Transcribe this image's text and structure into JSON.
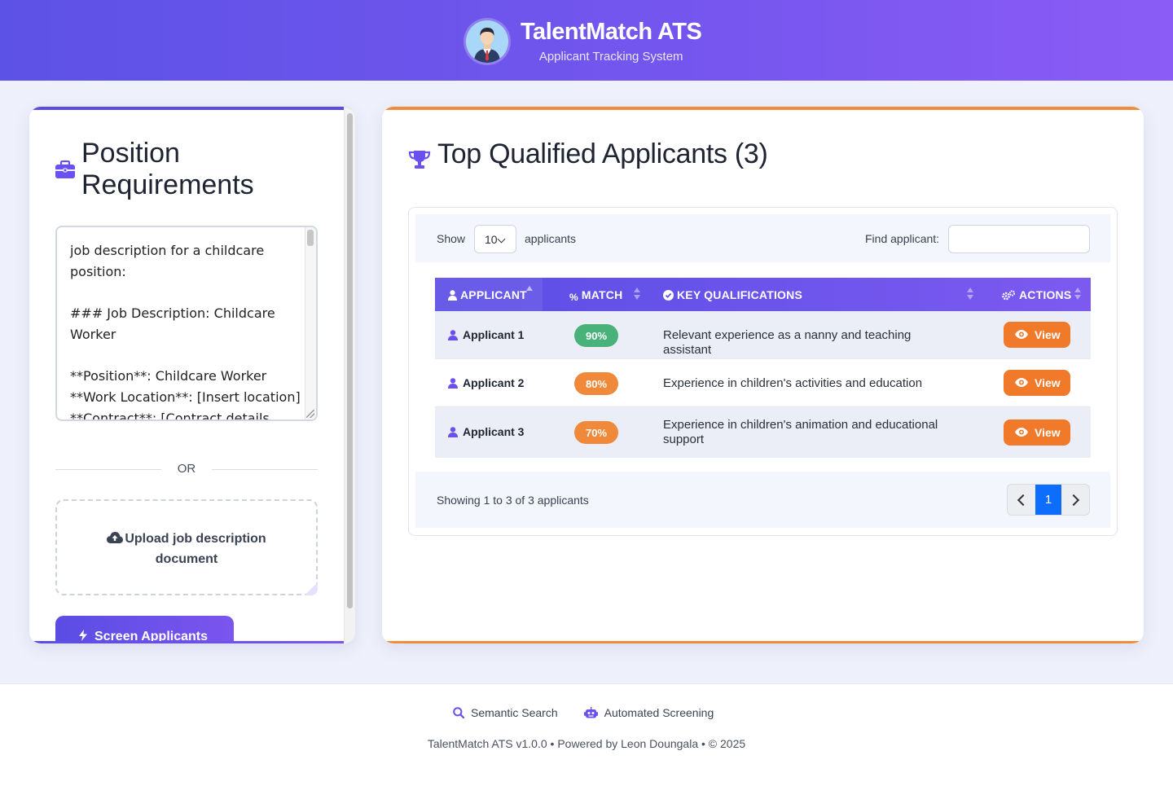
{
  "header": {
    "title": "TalentMatch ATS",
    "subtitle": "Applicant Tracking System"
  },
  "left": {
    "title": "Position Requirements",
    "job_description": "job description for a childcare position:\n\n### Job Description: Childcare Worker\n\n**Position**: Childcare Worker\n**Work Location**: [Insert location]\n**Contract**: [Contract details",
    "or_label": "OR",
    "upload_label": "Upload job description document",
    "screen_button": "Screen Applicants"
  },
  "right": {
    "title": "Top Qualified Applicants (3)",
    "show_label": "Show",
    "page_size": "10",
    "applicants_label": "applicants",
    "find_label": "Find applicant:",
    "find_value": "",
    "columns": [
      "APPLICANT",
      "MATCH",
      "KEY QUALIFICATIONS",
      "ACTIONS"
    ],
    "rows": [
      {
        "name": "Applicant 1",
        "match": "90%",
        "qualifications": "Relevant experience as a nanny and teaching assistant",
        "action": "View"
      },
      {
        "name": "Applicant 2",
        "match": "80%",
        "qualifications": "Experience in children's activities and education",
        "action": "View"
      },
      {
        "name": "Applicant 3",
        "match": "70%",
        "qualifications": "Experience in children's animation and educational support",
        "action": "View"
      }
    ],
    "info": "Showing 1 to 3 of 3 applicants",
    "current_page": "1"
  },
  "colors": {
    "primary": "#5b4de0",
    "accent": "#f07a2a",
    "match_high": "#48b27a",
    "match_mid": "#f08a3a",
    "page_active": "#0d6efd"
  },
  "footer": {
    "link1": "Semantic Search",
    "link2": "Automated Screening",
    "copyright": "TalentMatch ATS v1.0.0 • Powered by Leon Doungala • © 2025"
  }
}
